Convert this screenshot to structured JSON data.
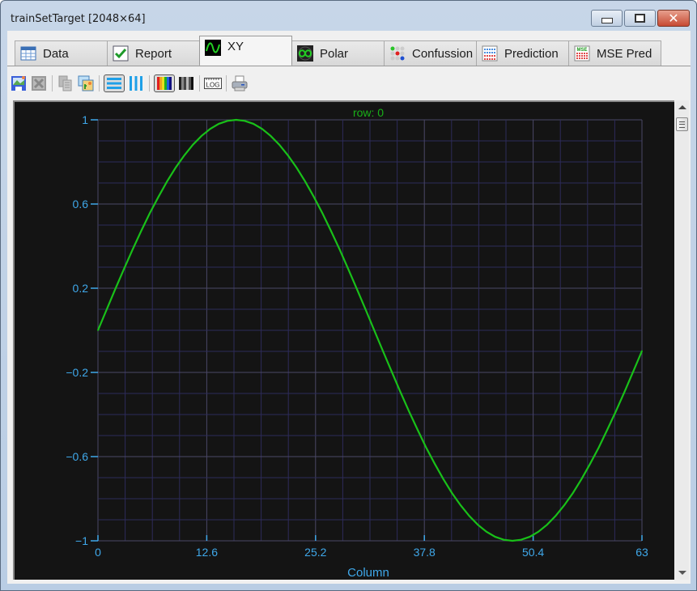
{
  "window": {
    "title": "trainSetTarget [2048×64]",
    "controls": {
      "minimize": "minimize-icon",
      "maximize": "maximize-icon",
      "close": "close-icon"
    }
  },
  "tabs": [
    {
      "label": "Data",
      "icon": "table-icon",
      "active": false
    },
    {
      "label": "Report",
      "icon": "checkmark-icon",
      "active": false
    },
    {
      "label": "XY",
      "icon": "sine-wave-icon",
      "active": true
    },
    {
      "label": "Polar",
      "icon": "polar-infinity-icon",
      "active": false
    },
    {
      "label": "Confussion",
      "icon": "dot-matrix-icon",
      "active": false
    },
    {
      "label": "Prediction",
      "icon": "grid-table-icon",
      "active": false
    },
    {
      "label": "MSE Pred",
      "icon": "mse-table-icon",
      "active": false
    }
  ],
  "toolbar": [
    {
      "icon": "save-image-icon"
    },
    {
      "icon": "delete-disabled-icon"
    },
    {
      "icon": "copy-disabled-icon"
    },
    {
      "icon": "copy-image-icon"
    },
    {
      "icon": "horizontal-rows-icon",
      "pressed": true
    },
    {
      "icon": "vertical-columns-icon"
    },
    {
      "icon": "color-palette-icon",
      "pressed": true
    },
    {
      "icon": "grayscale-palette-icon"
    },
    {
      "icon": "log-scale-icon",
      "text": "LOG"
    },
    {
      "icon": "print-icon"
    }
  ],
  "colors": {
    "plot_bg": "#141414",
    "grid": "#2d2b5a",
    "grid_major": "#4a4866",
    "axis_text": "#3fa8ea",
    "series": "#19c019",
    "title_text": "#19b019"
  },
  "chart_data": {
    "type": "line",
    "title": "row: 0",
    "xlabel": "Column",
    "ylabel": "",
    "xlim": [
      0,
      63
    ],
    "ylim": [
      -1,
      1
    ],
    "x_ticks": [
      "0",
      "12.6",
      "25.2",
      "37.8",
      "50.4",
      "63"
    ],
    "y_ticks": [
      "1",
      "0.6",
      "0.2",
      "-0.2",
      "-0.6",
      "-1"
    ],
    "y_tick_values": [
      1,
      0.6,
      0.2,
      -0.2,
      -0.6,
      -1
    ],
    "x_tick_values": [
      0,
      12.6,
      25.2,
      37.8,
      50.4,
      63
    ],
    "grid": true,
    "series": [
      {
        "name": "row 0",
        "x": [
          0,
          1,
          2,
          3,
          4,
          5,
          6,
          7,
          8,
          9,
          10,
          11,
          12,
          13,
          14,
          15,
          16,
          17,
          18,
          19,
          20,
          21,
          22,
          23,
          24,
          25,
          26,
          27,
          28,
          29,
          30,
          31,
          32,
          33,
          34,
          35,
          36,
          37,
          38,
          39,
          40,
          41,
          42,
          43,
          44,
          45,
          46,
          47,
          48,
          49,
          50,
          51,
          52,
          53,
          54,
          55,
          56,
          57,
          58,
          59,
          60,
          61,
          62,
          63
        ],
        "y": [
          0,
          0.098,
          0.195,
          0.29,
          0.383,
          0.471,
          0.556,
          0.634,
          0.707,
          0.773,
          0.831,
          0.882,
          0.924,
          0.957,
          0.981,
          0.995,
          1,
          0.995,
          0.981,
          0.957,
          0.924,
          0.882,
          0.831,
          0.773,
          0.707,
          0.634,
          0.556,
          0.471,
          0.383,
          0.29,
          0.195,
          0.098,
          0,
          -0.098,
          -0.195,
          -0.29,
          -0.383,
          -0.471,
          -0.556,
          -0.634,
          -0.707,
          -0.773,
          -0.831,
          -0.882,
          -0.924,
          -0.957,
          -0.981,
          -0.995,
          -1,
          -0.995,
          -0.981,
          -0.957,
          -0.924,
          -0.882,
          -0.831,
          -0.773,
          -0.707,
          -0.634,
          -0.556,
          -0.471,
          -0.383,
          -0.29,
          -0.195,
          -0.098
        ]
      }
    ]
  }
}
